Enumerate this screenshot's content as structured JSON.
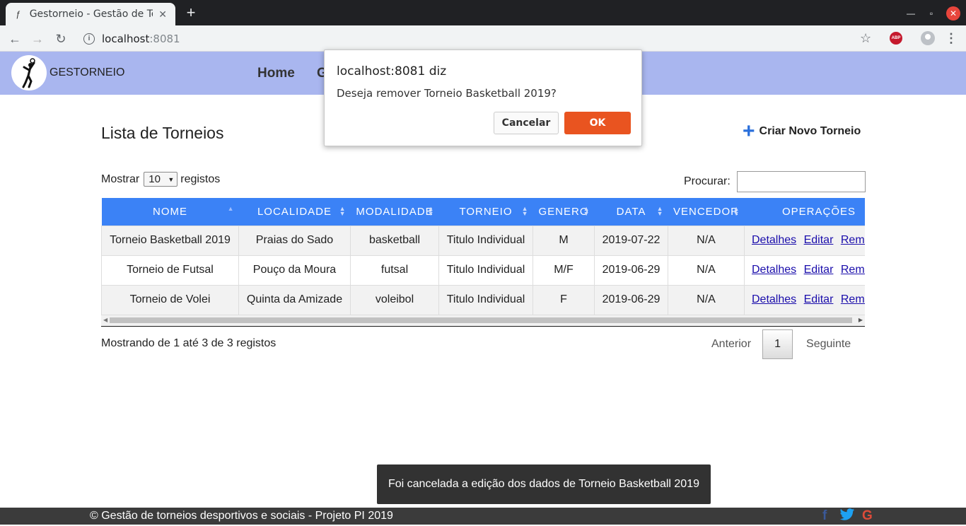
{
  "browser": {
    "tab_title": "Gestorneio - Gestão de Torneios",
    "tab_close": "✕",
    "new_tab": "+",
    "url_host": "localhost",
    "url_port": ":8081",
    "abp_label": "ABP"
  },
  "header": {
    "brand": "GESTORNEIO",
    "nav": [
      "Home",
      "G"
    ]
  },
  "page": {
    "title": "Lista de Torneios",
    "create_label": "Criar Novo Torneio"
  },
  "table_controls": {
    "show_label": "Mostrar",
    "page_length": "10",
    "records_label": "registos",
    "search_label": "Procurar:",
    "search_value": ""
  },
  "table": {
    "columns": [
      "NOME",
      "LOCALIDADE",
      "MODALIDADE",
      "TORNEIO",
      "GENERO",
      "DATA",
      "VENCEDOR",
      "OPERAÇÕES"
    ],
    "rows": [
      [
        "Torneio Basketball 2019",
        "Praias do Sado",
        "basketball",
        "Titulo Individual",
        "M",
        "2019-07-22",
        "N/A"
      ],
      [
        "Torneio de Futsal",
        "Pouço da Moura",
        "futsal",
        "Titulo Individual",
        "M/F",
        "2019-06-29",
        "N/A"
      ],
      [
        "Torneio de Volei",
        "Quinta da Amizade",
        "voleibol",
        "Titulo Individual",
        "F",
        "2019-06-29",
        "N/A"
      ]
    ],
    "op_links": [
      "Detalhes",
      "Editar",
      "Remover"
    ]
  },
  "pagination": {
    "info": "Mostrando de 1 até 3 de 3 registos",
    "prev": "Anterior",
    "current": "1",
    "next": "Seguinte"
  },
  "dialog": {
    "title": "localhost:8081 diz",
    "message": "Deseja remover Torneio Basketball 2019?",
    "cancel": "Cancelar",
    "ok": "OK"
  },
  "toast": {
    "message": "Foi cancelada a edição dos dados de Torneio Basketball 2019"
  },
  "footer": {
    "copyright": "© Gestão de torneios desportivos e sociais - Projeto PI 2019",
    "social": [
      "f",
      "G"
    ]
  },
  "colors": {
    "header_bg": "#a9b6ef",
    "table_header": "#3b82f6",
    "ok_button": "#e95420",
    "footer_bg": "#3b3b3b"
  }
}
